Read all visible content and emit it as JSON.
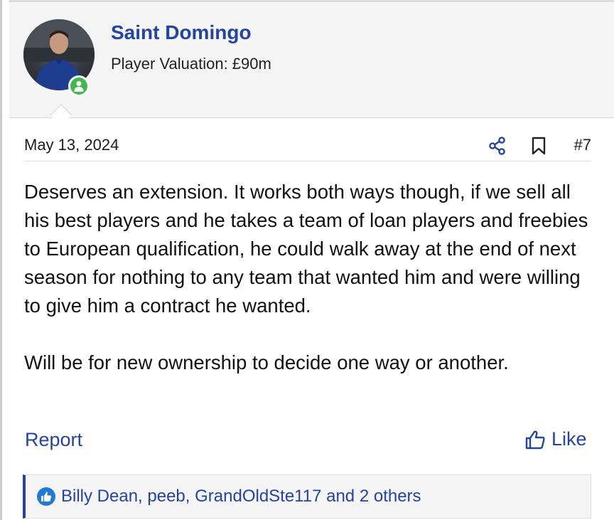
{
  "user": {
    "name": "Saint Domingo",
    "title": "Player Valuation: £90m",
    "status": "online"
  },
  "post": {
    "date": "May 13, 2024",
    "number": "#7",
    "paragraphs": [
      "Deserves an extension. It works both ways though, if we sell all his best players and he takes a team of loan players and freebies to European qualification, he could walk away at the end of next season for nothing to any team that wanted him and were willing to give him a contract he wanted.",
      "Will be for new ownership to decide one way or another."
    ]
  },
  "actions": {
    "report_label": "Report",
    "like_label": "Like"
  },
  "reactions": {
    "text": "Billy Dean, peeb, GrandOldSte117 and 2 others"
  },
  "icons": {
    "share": "share-icon",
    "bookmark": "bookmark-icon",
    "like": "thumbs-up-icon",
    "online": "user-online-icon"
  },
  "colors": {
    "link": "#2343a6",
    "online": "#3fb94e",
    "reaction": "#1f7bd8",
    "header_bg": "#f5f5f6"
  }
}
